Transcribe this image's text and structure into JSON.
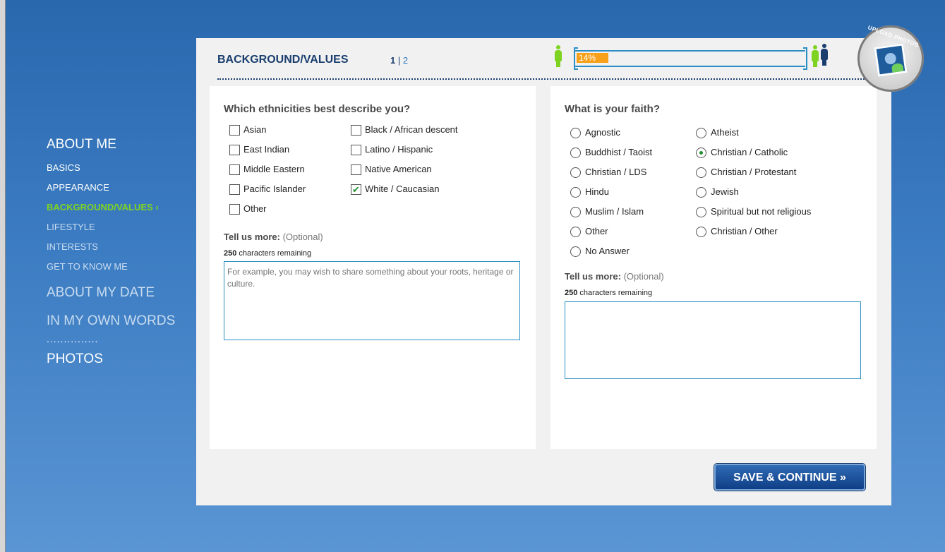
{
  "sidebar": {
    "about_me": "ABOUT ME",
    "basics": "BASICS",
    "appearance": "APPEARANCE",
    "background_values": "BACKGROUND/VALUES",
    "active_marker": "‹",
    "lifestyle": "LIFESTYLE",
    "interests": "INTERESTS",
    "get_to_know_me": "GET TO KNOW ME",
    "about_my_date": "ABOUT MY DATE",
    "in_my_own_words": "IN MY OWN WORDS",
    "dots": "...............",
    "photos": "PHOTOS"
  },
  "header": {
    "title": "BACKGROUND/VALUES",
    "page_current": "1",
    "page_sep": " | ",
    "page_next": "2"
  },
  "progress": {
    "percent": 14,
    "label": "14%"
  },
  "upload": {
    "label": "UPLOAD PHOTOS"
  },
  "ethnicity": {
    "question": "Which ethnicities best describe you?",
    "options": [
      {
        "label": "Asian",
        "checked": false
      },
      {
        "label": "Black / African descent",
        "checked": false
      },
      {
        "label": "East Indian",
        "checked": false
      },
      {
        "label": "Latino / Hispanic",
        "checked": false
      },
      {
        "label": "Middle Eastern",
        "checked": false
      },
      {
        "label": "Native American",
        "checked": false
      },
      {
        "label": "Pacific Islander",
        "checked": false
      },
      {
        "label": "White / Caucasian",
        "checked": true
      },
      {
        "label": "Other",
        "checked": false
      }
    ],
    "more_label": "Tell us more:",
    "optional": "(Optional)",
    "remaining_count": "250",
    "remaining_text": "characters remaining",
    "placeholder": "For example, you may wish to share something about your roots, heritage or culture."
  },
  "faith": {
    "question": "What is your faith?",
    "options": [
      {
        "label": "Agnostic",
        "checked": false
      },
      {
        "label": "Atheist",
        "checked": false
      },
      {
        "label": "Buddhist / Taoist",
        "checked": false
      },
      {
        "label": "Christian / Catholic",
        "checked": true
      },
      {
        "label": "Christian / LDS",
        "checked": false
      },
      {
        "label": "Christian / Protestant",
        "checked": false
      },
      {
        "label": "Hindu",
        "checked": false
      },
      {
        "label": "Jewish",
        "checked": false
      },
      {
        "label": "Muslim / Islam",
        "checked": false
      },
      {
        "label": "Spiritual but not religious",
        "checked": false
      },
      {
        "label": "Other",
        "checked": false
      },
      {
        "label": "Christian / Other",
        "checked": false
      },
      {
        "label": "No Answer",
        "checked": false
      }
    ],
    "more_label": "Tell us more:",
    "optional": "(Optional)",
    "remaining_count": "250",
    "remaining_text": "characters remaining"
  },
  "save_label": "SAVE & CONTINUE »",
  "colors": {
    "accent_green": "#7ed321",
    "brand_blue": "#1a3e6e",
    "progress_orange": "#f7a11a"
  }
}
